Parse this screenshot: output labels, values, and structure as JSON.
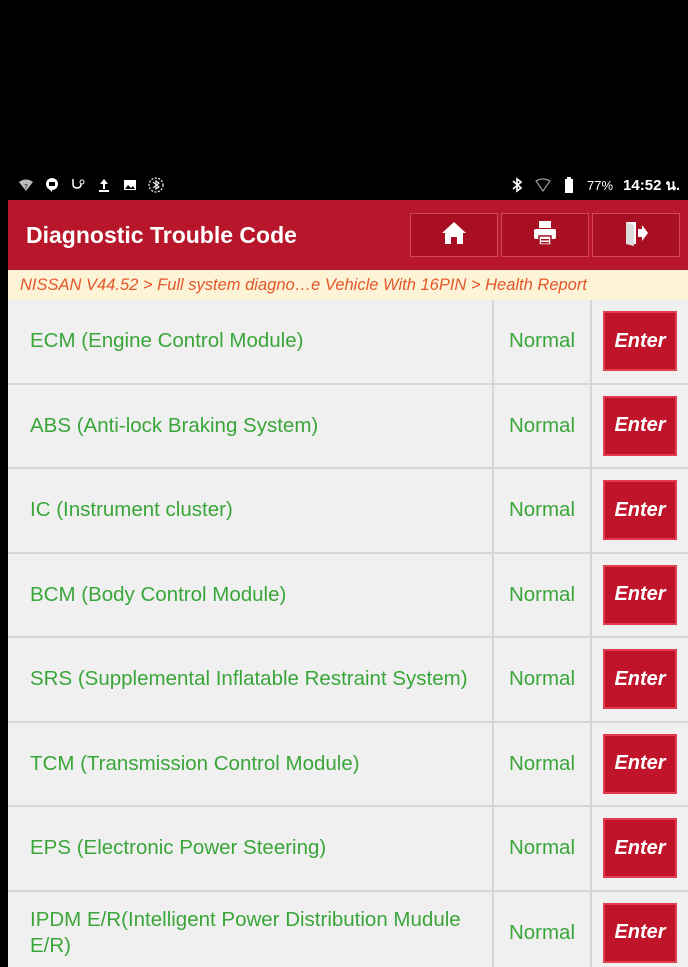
{
  "statusbar": {
    "left_icons": [
      "wifi-question-icon",
      "chat-bubble-icon",
      "stethoscope-icon",
      "upload-icon",
      "image-icon",
      "bluetooth-circle-icon"
    ],
    "battery": "77%",
    "time": "14:52 น."
  },
  "header": {
    "title": "Diagnostic Trouble Code",
    "buttons": [
      "home-icon",
      "print-icon",
      "exit-icon"
    ]
  },
  "breadcrumb": "NISSAN V44.52 > Full system diagno…e Vehicle With 16PIN > Health Report",
  "rows": [
    {
      "name": "ECM (Engine Control Module)",
      "status": "Normal",
      "action": "Enter"
    },
    {
      "name": "ABS (Anti-lock Braking System)",
      "status": "Normal",
      "action": "Enter"
    },
    {
      "name": "IC (Instrument cluster)",
      "status": "Normal",
      "action": "Enter"
    },
    {
      "name": "BCM (Body Control Module)",
      "status": "Normal",
      "action": "Enter"
    },
    {
      "name": "SRS (Supplemental Inflatable Restraint System)",
      "status": "Normal",
      "action": "Enter"
    },
    {
      "name": "TCM (Transmission Control Module)",
      "status": "Normal",
      "action": "Enter"
    },
    {
      "name": "EPS (Electronic Power Steering)",
      "status": "Normal",
      "action": "Enter"
    },
    {
      "name": "IPDM E/R(Intelligent Power Distribution Mudule E/R)",
      "status": "Normal",
      "action": "Enter"
    }
  ],
  "colors": {
    "header": "#b8162a",
    "accent_text": "#3aa63a",
    "breadcrumb_text": "#e4572a",
    "button": "#c0142a"
  }
}
